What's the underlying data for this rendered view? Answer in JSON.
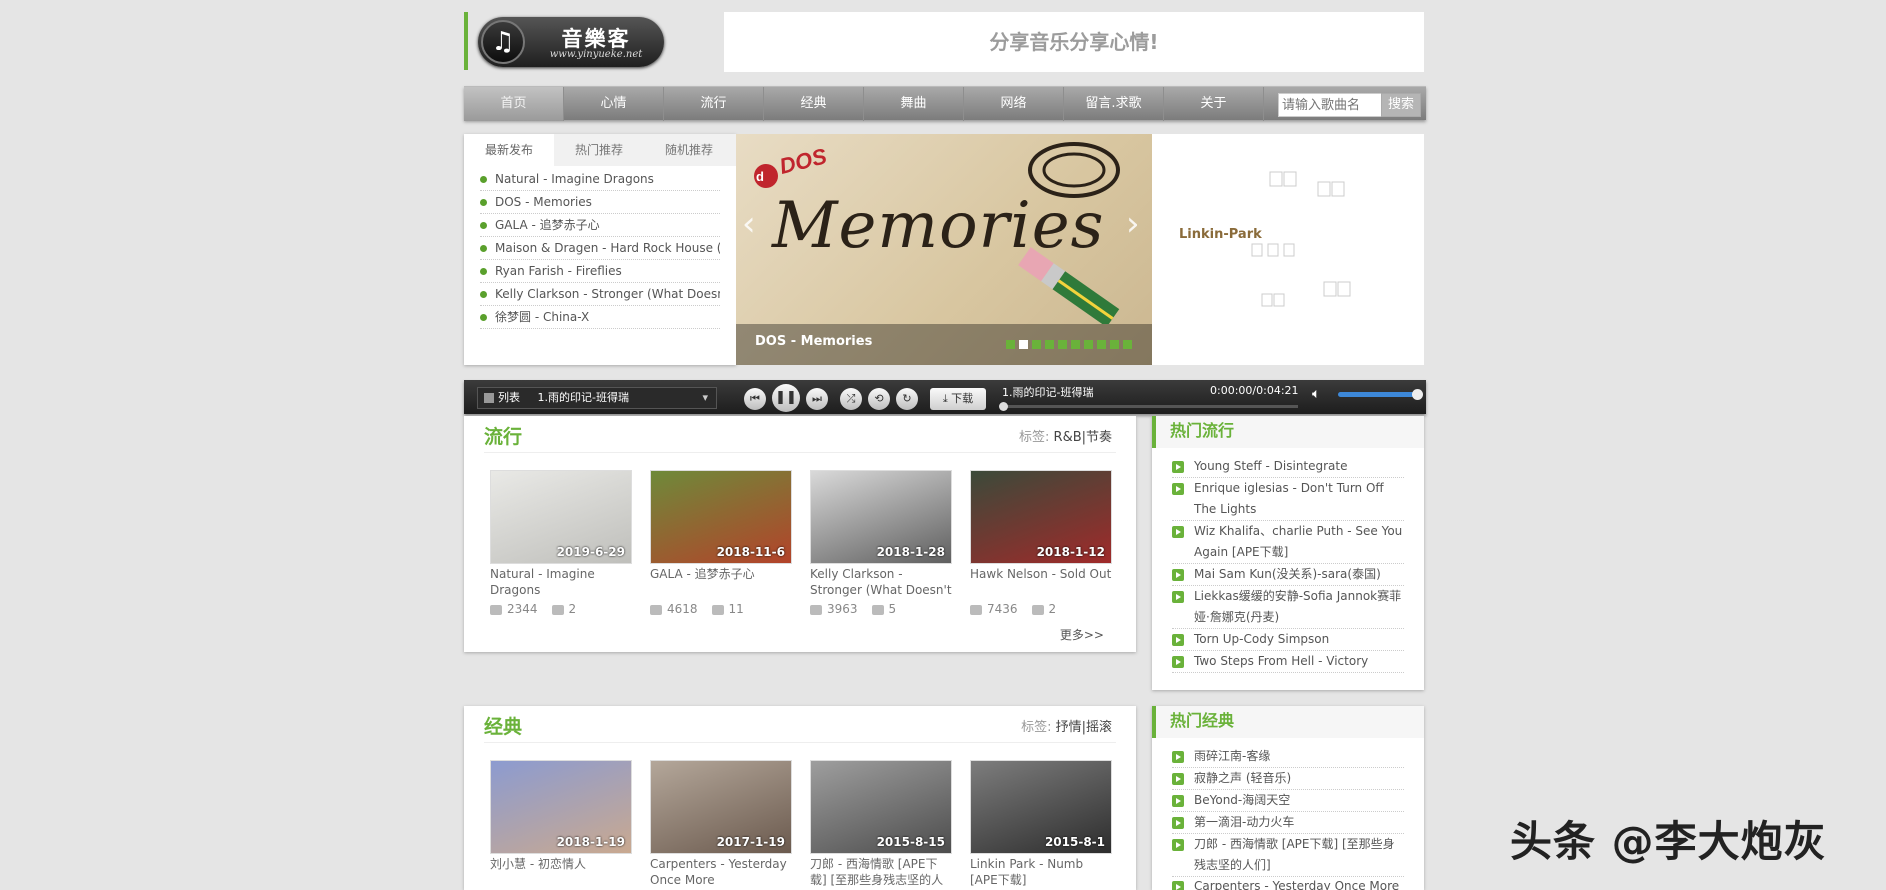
{
  "site": {
    "name": "音樂客",
    "url": "www.yinyueke.net",
    "slogan": "分享音乐分享心情!"
  },
  "nav": {
    "items": [
      "首页",
      "心情",
      "流行",
      "经典",
      "舞曲",
      "网络",
      "留言.求歌",
      "关于"
    ],
    "search_placeholder": "请输入歌曲名",
    "search_button": "搜索"
  },
  "latest": {
    "tabs": [
      "最新发布",
      "热门推荐",
      "随机推荐"
    ],
    "songs": [
      "Natural - Imagine Dragons",
      "DOS - Memories",
      "GALA - 追梦赤子心",
      "Maison & Dragen - Hard Rock House (Rad",
      "Ryan Farish - Fireflies",
      "Kelly Clarkson - Stronger (What Doesn't K",
      "徐梦圆 - China-X"
    ]
  },
  "banner": {
    "title": "Memories",
    "caption": "DOS - Memories",
    "slides": 10,
    "active_slide": 2,
    "side_label": "Linkin-Park"
  },
  "player": {
    "list_label": "列表",
    "current_track": "1.雨的印记-班得瑞",
    "download_label": "下载",
    "time": "0:00:00/0:04:21",
    "progress": 0.0,
    "volume": 1.0
  },
  "sections": [
    {
      "title": "流行",
      "tags_label": "标签:",
      "tags": "R&B|节奏",
      "more": "更多>>",
      "cards": [
        {
          "title": "Natural - Imagine Dragons",
          "date": "2019-6-29",
          "plays": "2344",
          "comments": "2",
          "colors": [
            "#e9e9e6",
            "#bfbfbb"
          ]
        },
        {
          "title": "GALA - 追梦赤子心",
          "date": "2018-11-6",
          "plays": "4618",
          "comments": "11",
          "colors": [
            "#6e8a3a",
            "#b3432a"
          ]
        },
        {
          "title": "Kelly Clarkson - Stronger (What Doesn't Kill You)",
          "date": "2018-1-28",
          "plays": "3963",
          "comments": "5",
          "colors": [
            "#d9d9d9",
            "#5f5f5f"
          ]
        },
        {
          "title": "Hawk Nelson - Sold Out",
          "date": "2018-1-12",
          "plays": "7436",
          "comments": "2",
          "colors": [
            "#3b4a3a",
            "#a02a2a"
          ]
        }
      ]
    },
    {
      "title": "经典",
      "tags_label": "标签:",
      "tags": "抒情|摇滚",
      "cards": [
        {
          "title": "刘小慧 - 初恋情人",
          "date": "2018-1-19",
          "colors": [
            "#8c9bd0",
            "#c9a990"
          ]
        },
        {
          "title": "Carpenters - Yesterday Once More",
          "date": "2017-1-19",
          "colors": [
            "#b4a79a",
            "#6b5a4e"
          ]
        },
        {
          "title": "刀郎 - 西海情歌 [APE下载] [至那些身残志坚的人",
          "date": "2015-8-15",
          "colors": [
            "#9e9e9e",
            "#4d4d4d"
          ]
        },
        {
          "title": "Linkin Park - Numb [APE下载]",
          "date": "2015-8-1",
          "colors": [
            "#7d7d7d",
            "#2d2d2d"
          ]
        }
      ]
    }
  ],
  "hot": [
    {
      "title": "热门流行",
      "items": [
        "Young Steff - Disintegrate",
        "Enrique iglesias - Don't Turn Off The Lights",
        "Wiz Khalifa、charlie Puth - See You Again [APE下载]",
        "Mai Sam Kun(没关系)-sara(泰国)",
        "Liekkas缓缓的安静-Sofia Jannok赛菲娅·詹娜克(丹麦)",
        "Torn Up-Cody Simpson",
        "Two Steps From Hell - Victory"
      ]
    },
    {
      "title": "热门经典",
      "items": [
        "雨碎江南-客缘",
        "寂静之声 (轻音乐)",
        "BeYond-海阔天空",
        "第一滴泪-动力火车",
        "刀郎 - 西海情歌 [APE下载] [至那些身残志坚的人们]",
        "Carpenters - Yesterday Once More"
      ]
    }
  ],
  "watermark": "头条 @李大炮灰",
  "colors": {
    "accent": "#6ab23a",
    "nav": "#8c8c8c",
    "player": "#2a2a2a",
    "volume": "#3d88d8"
  }
}
